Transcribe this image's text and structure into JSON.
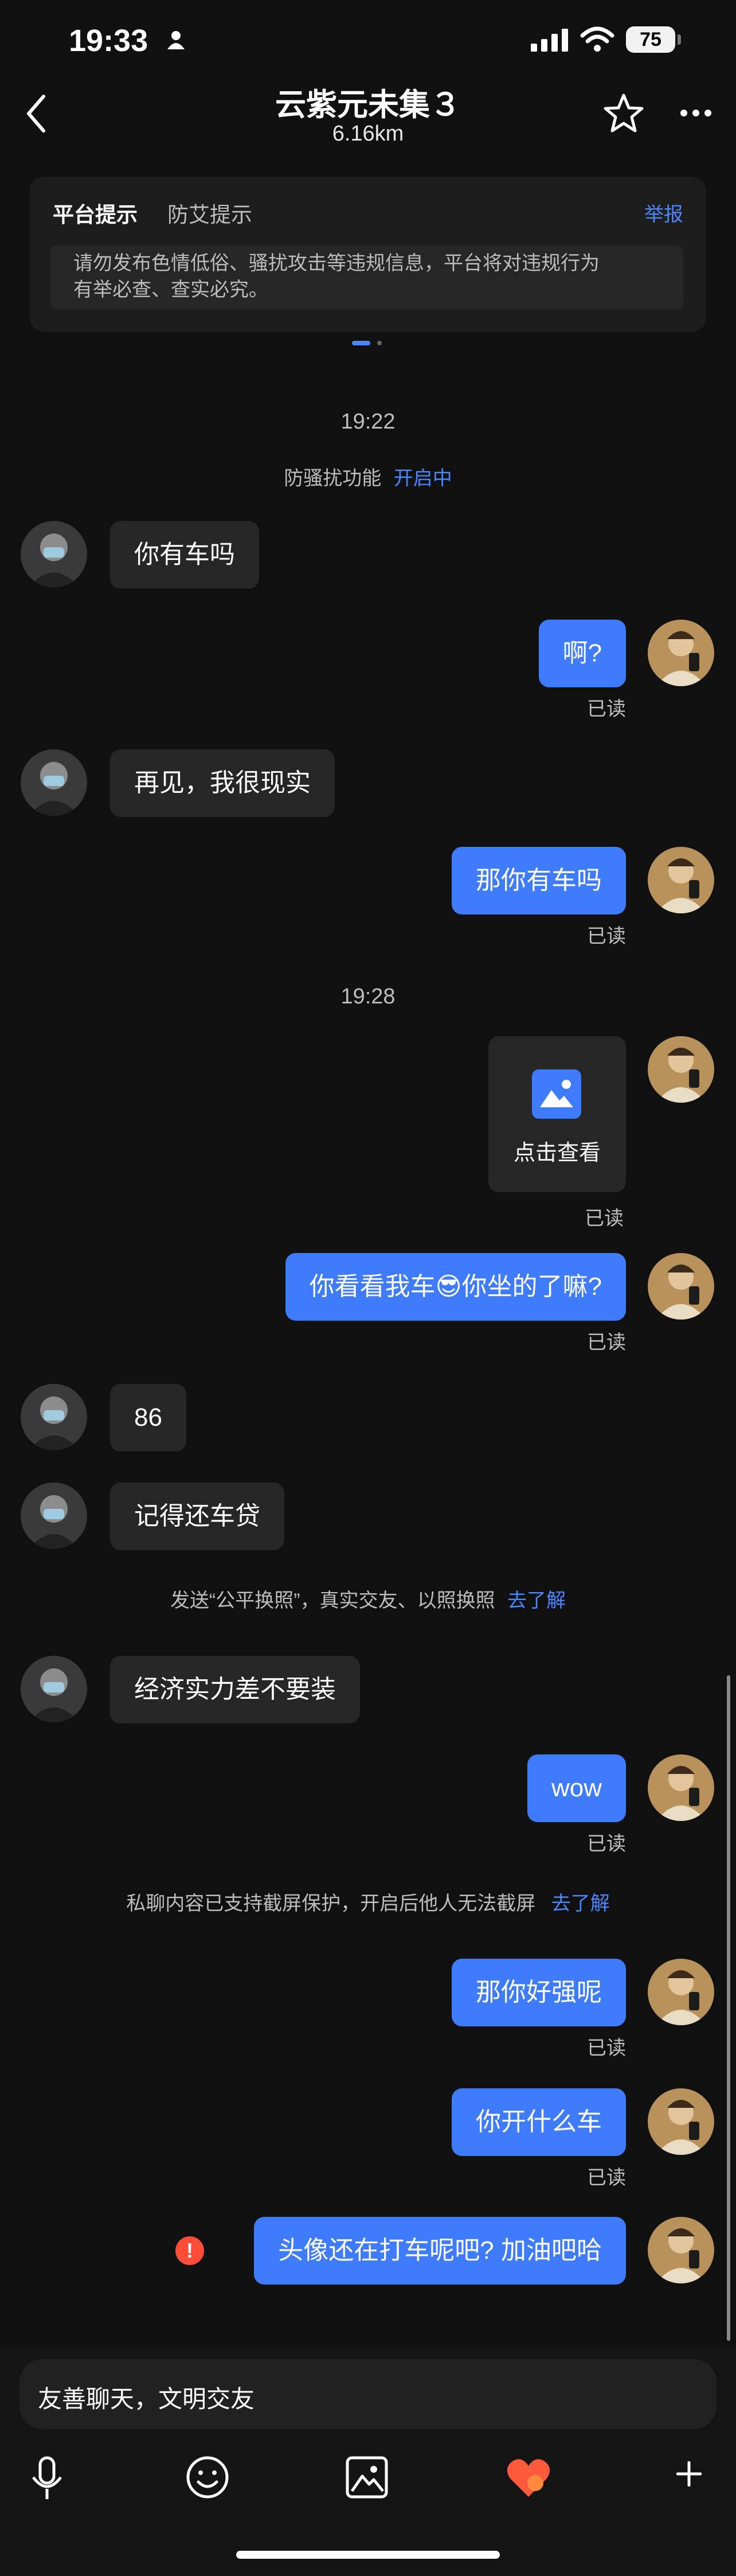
{
  "status_bar": {
    "time": "19:33",
    "battery": "75",
    "icons": [
      "person-icon",
      "cellular-signal-icon",
      "wifi-icon",
      "battery-icon"
    ]
  },
  "header": {
    "title": "云紫元未集３",
    "subtitle": "6.16km",
    "icons": [
      "back-icon",
      "star-icon",
      "more-icon"
    ]
  },
  "notice": {
    "tab_platform": "平台提示",
    "tab_aids": "防艾提示",
    "report": "举报",
    "line1": "请勿发布色情低俗、骚扰攻击等违规信息，平台将对违规行为",
    "line2": "有举必查、查实必究。"
  },
  "chat": {
    "time1": "19:22",
    "anti_harass_label": "防骚扰功能",
    "anti_harass_status": "开启中",
    "msg1": "你有车吗",
    "msg2": "啊?",
    "msg3": "再见，我很现实",
    "msg4": "那你有车吗",
    "time2": "19:28",
    "image_label": "点击查看",
    "msg5_part1": "你看看我车",
    "msg5_emoji": "😎",
    "msg5_part2": "你坐的了嘛?",
    "msg6": "86",
    "msg7": "记得还车贷",
    "sys1_text": "发送“公平换照”，真实交友、以照换照",
    "sys1_link": "去了解",
    "msg8": "经济实力差不要装",
    "msg9": "wow",
    "sys2_text": "私聊内容已支持截屏保护，开启后他人无法截屏",
    "sys2_link": "去了解",
    "msg10": "那你好强呢",
    "msg11": "你开什么车",
    "msg12": "头像还在打车呢吧? 加油吧哈",
    "read_label": "已读",
    "error_mark": "!"
  },
  "input": {
    "placeholder": "友善聊天，文明交友"
  },
  "toolbar": [
    "microphone-icon",
    "emoji-icon",
    "image-icon",
    "heart-gift-icon",
    "plus-icon"
  ],
  "colors": {
    "background": "#101010",
    "incoming_bubble": "#262626",
    "outgoing_bubble": "#3f7bfd",
    "link": "#4a86ff",
    "error": "#ff4d3a"
  }
}
